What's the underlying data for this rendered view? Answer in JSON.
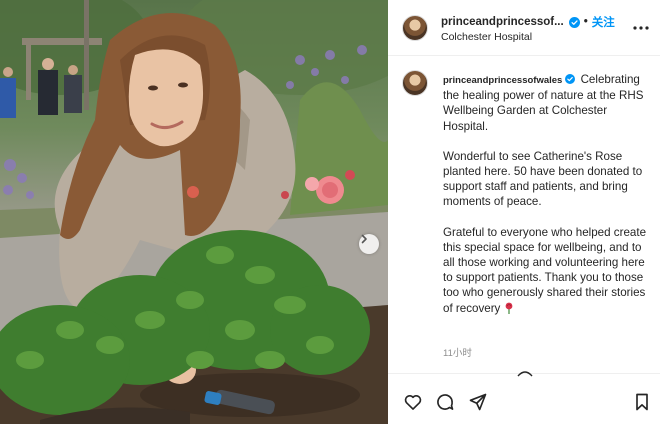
{
  "colors": {
    "accent": "#0095f6",
    "text": "#262626",
    "muted": "#8e8e8e",
    "divider": "#efefef"
  },
  "post": {
    "image_alt": "Catherine planting a rose in the RHS Wellbeing Garden",
    "carousel_next_icon": "chevron-right-icon"
  },
  "header": {
    "username": "princeandprincessof...",
    "separator": "•",
    "follow_label": "关注",
    "location": "Colchester Hospital",
    "more_icon": "more-horizontal-icon"
  },
  "caption": {
    "username": "princeandprincessofwales",
    "paragraphs": [
      "Celebrating the healing power of nature at the RHS Wellbeing Garden at Colchester Hospital.",
      "Wonderful to see Catherine's Rose planted here. 50 have been donated to support staff and patients, and bring moments of peace.",
      "Grateful to everyone who helped create this special space for wellbeing, and to all those working and volunteering here to support patients. Thank you to those too who generously shared their stories of recovery"
    ],
    "emoji": "🌹",
    "timestamp": "11小时"
  },
  "actions": {
    "like_icon": "heart-icon",
    "comment_icon": "comment-icon",
    "share_icon": "share-icon",
    "save_icon": "bookmark-icon"
  }
}
